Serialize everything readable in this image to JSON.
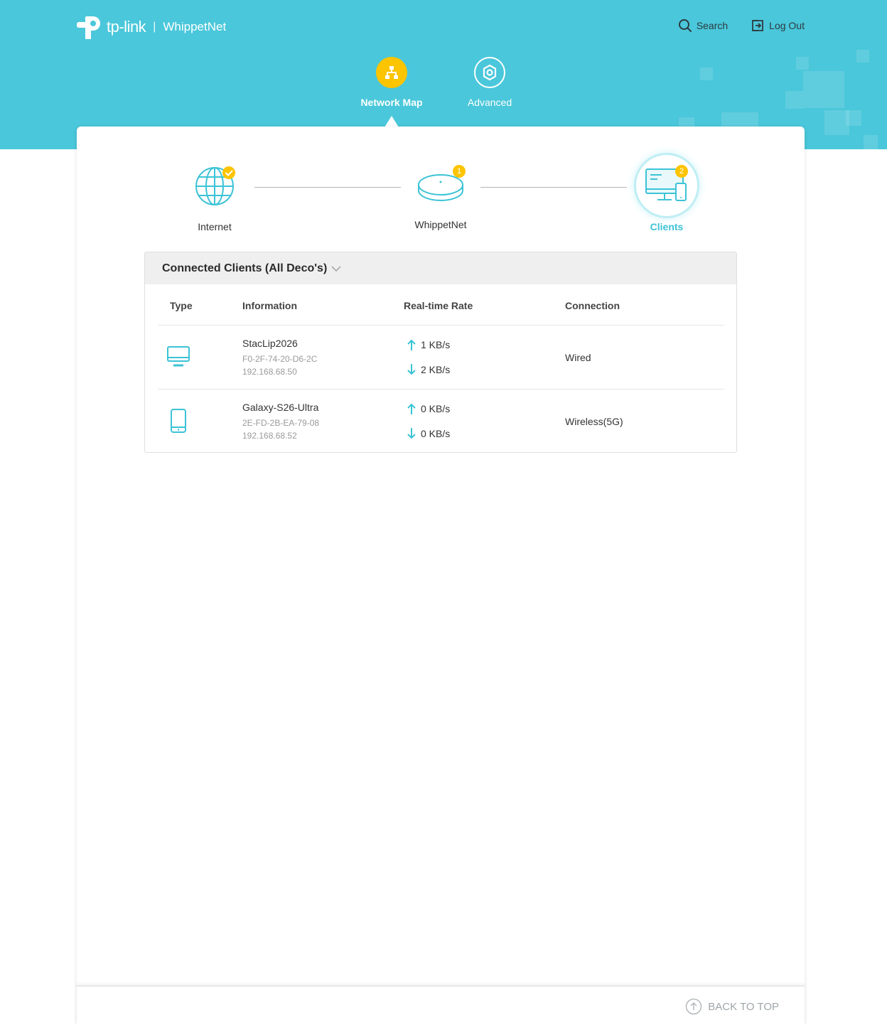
{
  "header": {
    "brand": "tp-link",
    "separator": "|",
    "network_name": "WhippetNet",
    "search_label": "Search",
    "logout_label": "Log Out"
  },
  "nav": {
    "tabs": [
      {
        "label": "Network Map",
        "icon": "network-map-icon",
        "active": true
      },
      {
        "label": "Advanced",
        "icon": "gear-icon",
        "active": false
      }
    ]
  },
  "topology": {
    "internet_label": "Internet",
    "deco_label": "WhippetNet",
    "deco_badge": "1",
    "clients_label": "Clients",
    "clients_badge": "2"
  },
  "clients_panel": {
    "title": "Connected Clients (All Deco's)",
    "columns": [
      "Type",
      "Information",
      "Real-time Rate",
      "Connection"
    ],
    "rows": [
      {
        "type": "monitor-icon",
        "name": "StacLip2026",
        "mac": "F0-2F-74-20-D6-2C",
        "ip": "192.168.68.50",
        "up": "1 KB/s",
        "down": "2 KB/s",
        "connection": "Wired"
      },
      {
        "type": "phone-icon",
        "name": "Galaxy-S26-Ultra",
        "mac": "2E-FD-2B-EA-79-08",
        "ip": "192.168.68.52",
        "up": "0 KB/s",
        "down": "0 KB/s",
        "connection": "Wireless(5G)"
      }
    ]
  },
  "footer": {
    "back_to_top": "BACK TO TOP"
  },
  "colors": {
    "accent": "#4ac7da",
    "badge": "#fdc400",
    "icon": "#3cc3d6"
  }
}
